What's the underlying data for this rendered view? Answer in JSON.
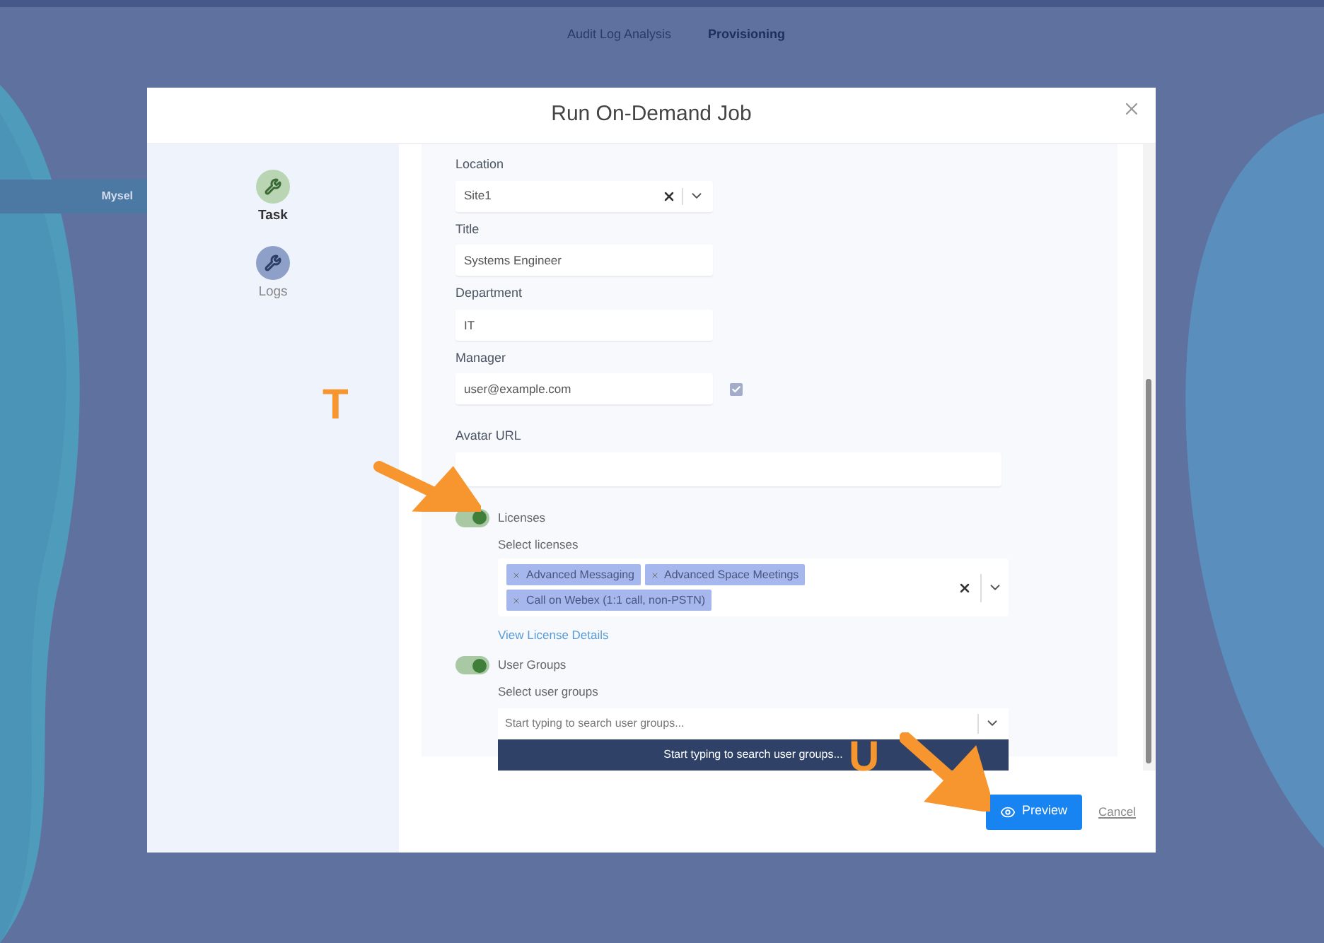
{
  "background": {
    "tabs": [
      {
        "label": "Audit Log Analysis",
        "selected": false
      },
      {
        "label": "Provisioning",
        "selected": true
      }
    ],
    "side_item": "Mysel"
  },
  "dialog": {
    "title": "Run On-Demand Job",
    "steps": [
      {
        "label": "Task",
        "selected": true
      },
      {
        "label": "Logs",
        "selected": false
      }
    ],
    "fields": [
      {
        "kind": "select",
        "label": "Location",
        "value": "Site1"
      },
      {
        "kind": "text",
        "label": "Title",
        "value": "Systems Engineer"
      },
      {
        "kind": "text",
        "label": "Department",
        "value": "IT"
      },
      {
        "kind": "checked-text",
        "label": "Manager",
        "value": "user@example.com",
        "checked": true
      },
      {
        "kind": "wide",
        "label": "Avatar URL"
      }
    ],
    "licenses": {
      "label": "Licenses",
      "on": true,
      "select_label": "Select licenses",
      "chips": [
        "Advanced Messaging",
        "Advanced Space Meetings",
        "Call on Webex (1:1 call, non-PSTN)"
      ],
      "link": "View License Details"
    },
    "user_groups": {
      "label": "User Groups",
      "on": true,
      "select_label": "Select user groups",
      "placeholder": "Start typing to search user groups...",
      "hint": "Start typing to search user groups..."
    },
    "buttons": {
      "primary": "Preview",
      "secondary": "Cancel"
    }
  },
  "annotations": [
    {
      "letter": "T"
    },
    {
      "letter": "U"
    }
  ]
}
